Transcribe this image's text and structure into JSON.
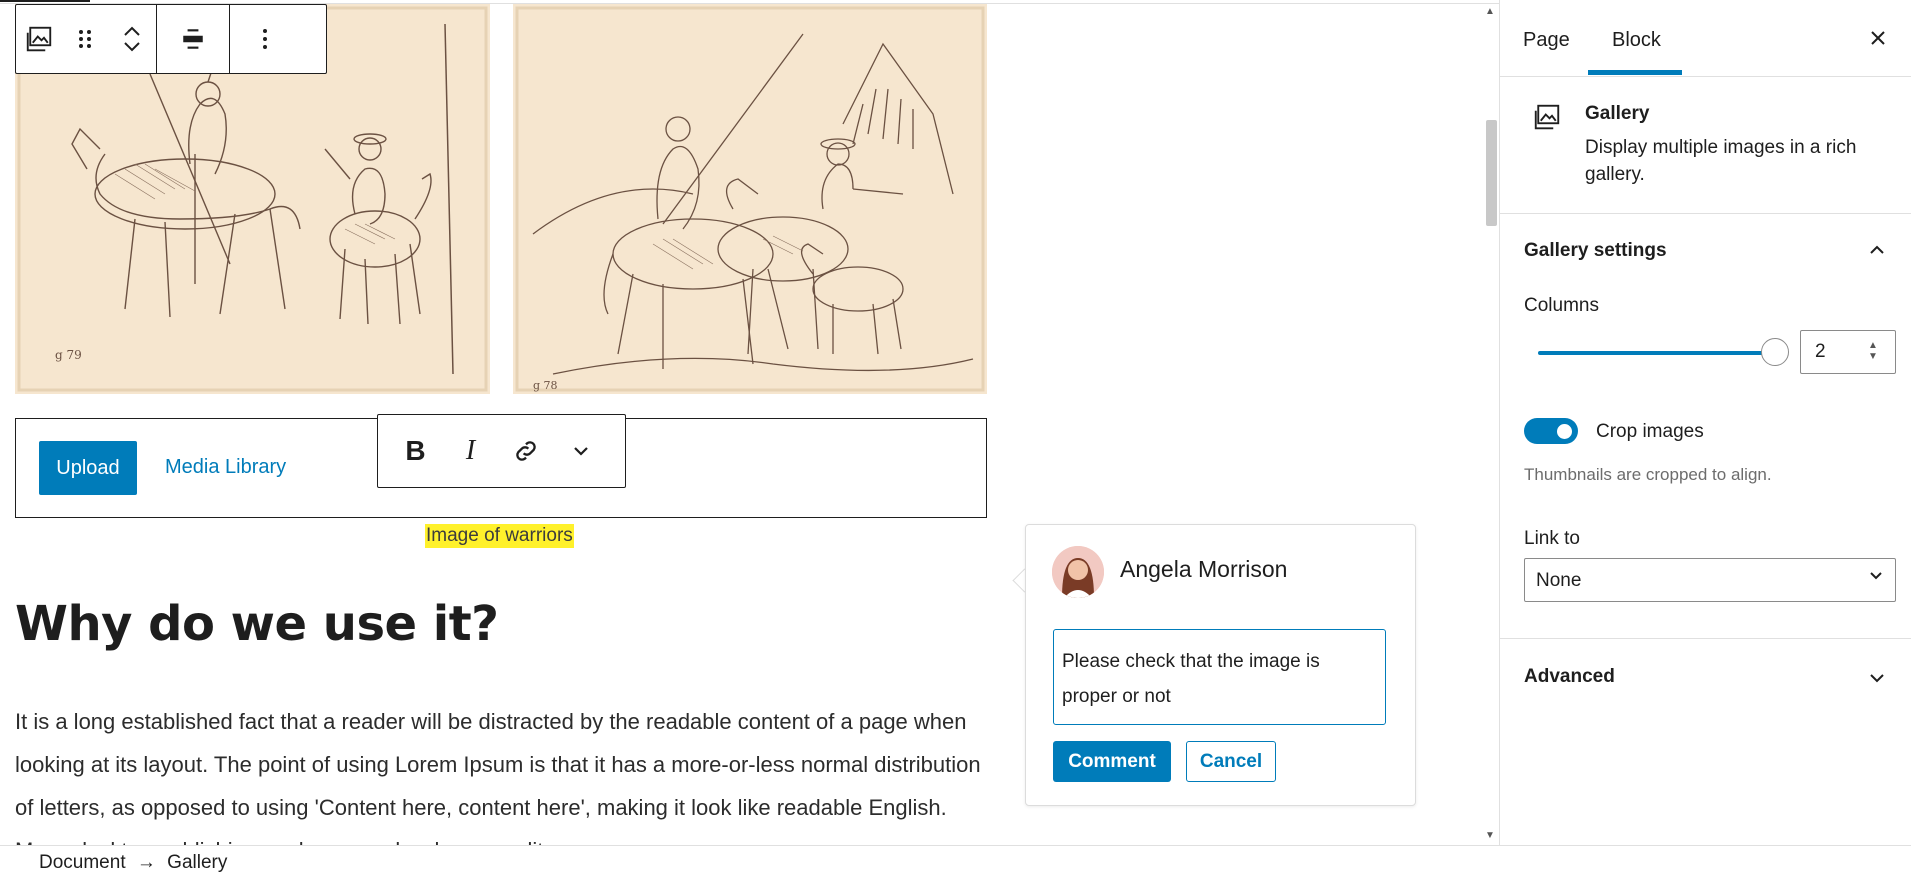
{
  "block_toolbar": {
    "icons": [
      "gallery-icon",
      "drag-handle-icon",
      "move-up-icon",
      "move-down-icon",
      "align-icon",
      "more-options-icon"
    ]
  },
  "upload": {
    "upload_label": "Upload",
    "media_library_label": "Media Library"
  },
  "format_toolbar": {
    "bold": "B",
    "italic": "I",
    "icons": [
      "bold-icon",
      "italic-icon",
      "link-icon",
      "more-chevron-icon"
    ]
  },
  "caption": "Image of warriors",
  "content": {
    "heading": "Why do we use it?",
    "paragraph": "It is a long established fact that a reader will be distracted by the readable content of a page when looking at its layout. The point of using Lorem Ipsum is that it has a more-or-less normal distribution of letters, as opposed to using 'Content here, content here', making it look like readable English. Many desktop publishing packages and web page editors now"
  },
  "comment": {
    "author": "Angela Morrison",
    "text": "Please check that the image is proper or not",
    "submit_label": "Comment",
    "cancel_label": "Cancel"
  },
  "breadcrumb": {
    "root": "Document",
    "separator": "→",
    "current": "Gallery"
  },
  "sidebar": {
    "tabs": [
      {
        "label": "Page",
        "active": false
      },
      {
        "label": "Block",
        "active": true
      }
    ],
    "close_icon": "close-icon",
    "block": {
      "name": "Gallery",
      "description": "Display multiple images in a rich gallery."
    },
    "gallery_settings": {
      "title": "Gallery settings",
      "columns_label": "Columns",
      "columns_value": "2",
      "columns_max": 8,
      "crop_label": "Crop images",
      "crop_enabled": true,
      "crop_help": "Thumbnails are cropped to align.",
      "link_to_label": "Link to",
      "link_to_value": "None"
    },
    "advanced": {
      "title": "Advanced"
    }
  },
  "colors": {
    "accent": "#007cba",
    "highlight": "#fff12b",
    "paper": "#f6e6cf",
    "ink": "#6b5142"
  }
}
